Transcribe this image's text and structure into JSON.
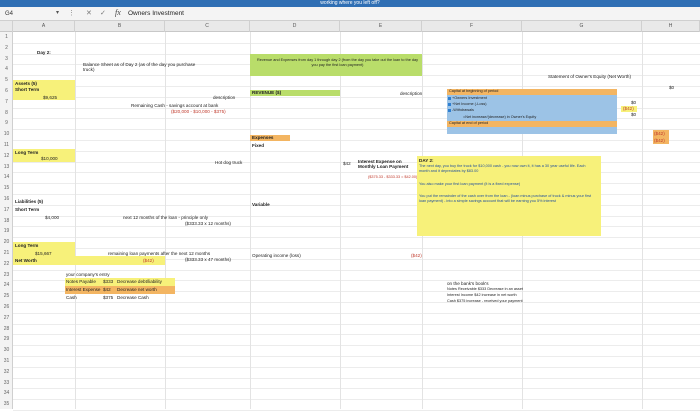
{
  "window": {
    "title": "working where you left off?"
  },
  "formula_bar": {
    "cell_ref": "G4",
    "formula": "Owners Investment",
    "fx": "fx"
  },
  "columns": [
    "A",
    "B",
    "C",
    "D",
    "E",
    "F",
    "G",
    "H"
  ],
  "rows": [
    "1",
    "2",
    "3",
    "4",
    "5",
    "6",
    "7",
    "8",
    "9",
    "10",
    "11",
    "12",
    "13",
    "14",
    "15",
    "16",
    "17",
    "18",
    "19",
    "20",
    "21",
    "22",
    "23",
    "24",
    "25",
    "26",
    "27",
    "28",
    "29",
    "30",
    "31",
    "32",
    "33",
    "34",
    "35"
  ],
  "col_a": {
    "day2": "Day 2:",
    "assets": "Assets (5)",
    "short_term_a": "Short Term",
    "short_term_a_val": "$9,625",
    "long_term_a": "Long Term",
    "long_term_a_val": "$10,000",
    "liabilities": "Liabilities (5)",
    "short_term_l": "Short Term",
    "short_term_l_val": "$4,000",
    "long_term_l": "Long Term",
    "long_term_l_val": "$15,667",
    "net_worth": "Net Worth"
  },
  "col_b": {
    "header": "Balance Sheet as of Day 2 (as of the day you purchase truck)",
    "description": "description",
    "remaining_cash": "Remaining Cash - savings account at bank",
    "remaining_cash_calc": "($20,000 - $10,000 - $375)",
    "hot_dog_truck": "Hot dog truck",
    "next12": "next 12 months of the loan - principle only",
    "next12_calc": "($333.33 x 12 months)",
    "remaining_loan": "remaining loan payments after the next 12 months",
    "remaining_loan_calc": "($333.33 x 47 months)",
    "net_worth_val": "($42)",
    "entry_title": "your company's entry",
    "entry_rows": [
      {
        "acct": "Notes Payable",
        "amt": "$333",
        "desc": "Decrease debt/liability"
      },
      {
        "acct": "Interest Expense",
        "amt": "$42",
        "desc": "Decrease net worth"
      },
      {
        "acct": "Cash",
        "amt": "$375",
        "desc": "Decrease Cash"
      }
    ]
  },
  "col_d": {
    "header": "Revenue and Expenses from day 1 through day 2 (from the day you take out the loan to the day you pay the first loan payment)",
    "revenue": "REVENUE ($)",
    "description": "description",
    "expenses": "Expenses",
    "fixed": "Fixed",
    "interest_amt": "$42",
    "interest_label": "Interest Expense on Monthly Loan Payment",
    "interest_calc": "($375.33 - $333.33 = $42.00)",
    "variable": "Variable",
    "operating_income": "Operating income (loss)",
    "operating_income_val": "($42)"
  },
  "col_g": {
    "header": "Statement of Owner's Equity (Net Worth)",
    "capital_begin": "Capital at beginning of period",
    "owners_investment": "+Owners Investment",
    "net_income": "+Net Income (-Loss)",
    "withdrawals": "-Withdrawals",
    "net_change": "=Net increase/(decrease) in Owner's Equity",
    "capital_end": "Capital at end of period",
    "v_top": "$0",
    "v_owner": "$0",
    "v_income": "($42)",
    "v_withdraw": "$0",
    "v_change": "($42)",
    "v_end": "($42)",
    "v_h1": "$0",
    "day2_title": "DAY 2:",
    "day2_text1": "The next day, you buy the truck for $10,000 cash - you now own it, it has a 30 year useful life. Each month and it depreciates by $83.00",
    "day2_text2": "You also make your first loan payment (it is a fixed expense)",
    "day2_text3": "You put the remainder of the cash over from the loan - (loan minus purchase of truck & minus your first loan payment) - into a simple savings account that will be earning you 5% interest",
    "bank_title": "on the bank's book's",
    "bank_line1": "Notes Receivable $333 Decrease in an asset",
    "bank_line2": "Interest Income $42 increase in net worth",
    "bank_line3": "Cash $375 increase - received your payment"
  },
  "colors": {
    "yellow": "#f7f17a",
    "green": "#b9dd6a",
    "orange": "#f3b562",
    "blue_fill": "#9cc3e6",
    "blue_sq": "#2e7fd1",
    "red": "#c0392b"
  }
}
